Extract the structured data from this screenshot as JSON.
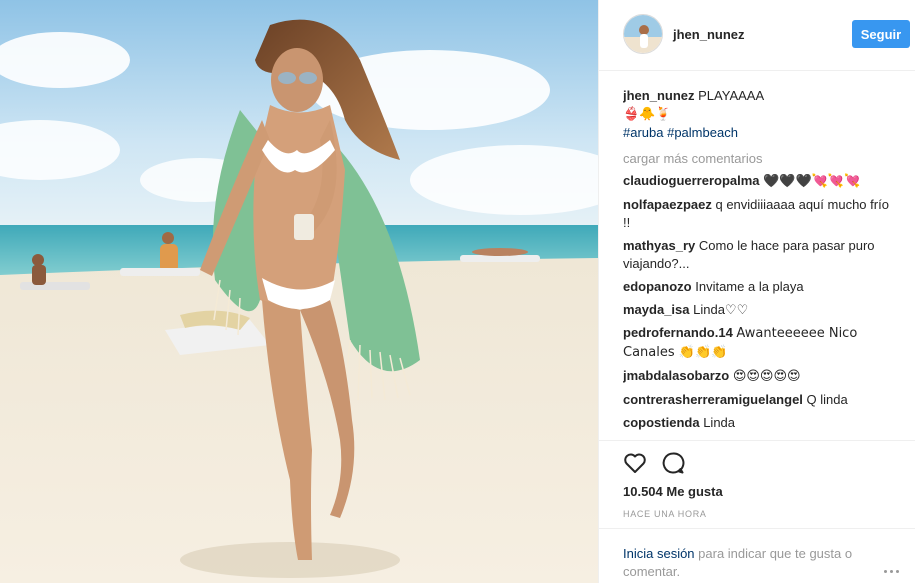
{
  "header": {
    "username": "jhen_nunez",
    "follow_label": "Seguir"
  },
  "caption": {
    "username": "jhen_nunez",
    "text": "PLAYAAAA",
    "emojis": "👙🐥🍹",
    "hashtags": "#aruba #palmbeach"
  },
  "load_more": "cargar más comentarios",
  "comments": [
    {
      "user": "claudioguerreropalma",
      "text": "🖤🖤🖤💘💘💘"
    },
    {
      "user": "nolfapaezpaez",
      "text": "q envidiiiaaaa aquí mucho frío !!"
    },
    {
      "user": "mathyas_ry",
      "text": "Como le hace para pasar puro viajando?..."
    },
    {
      "user": "edopanozo",
      "text": "Invitame a la playa"
    },
    {
      "user": "mayda_isa",
      "text": "Linda♡♡"
    },
    {
      "user": "pedrofernando.14",
      "text": "Awanteeeeee Nico Canales 👏👏👏"
    },
    {
      "user": "jmabdalasobarzo",
      "text": "😍😍😍😍😍"
    },
    {
      "user": "contrerasherreramiguelangel",
      "text": "Q linda"
    },
    {
      "user": "copostienda",
      "text": "Linda"
    }
  ],
  "actions": {
    "like_icon": "heart-outline-icon",
    "comment_icon": "speech-bubble-icon"
  },
  "likes_text": "10.504 Me gusta",
  "timestamp": "HACE UNA HORA",
  "login": {
    "link_text": "Inicia sesión",
    "rest_text": " para indicar que te gusta o comentar."
  },
  "colors": {
    "accent": "#3897f0",
    "link": "#003569",
    "muted": "#999999"
  }
}
